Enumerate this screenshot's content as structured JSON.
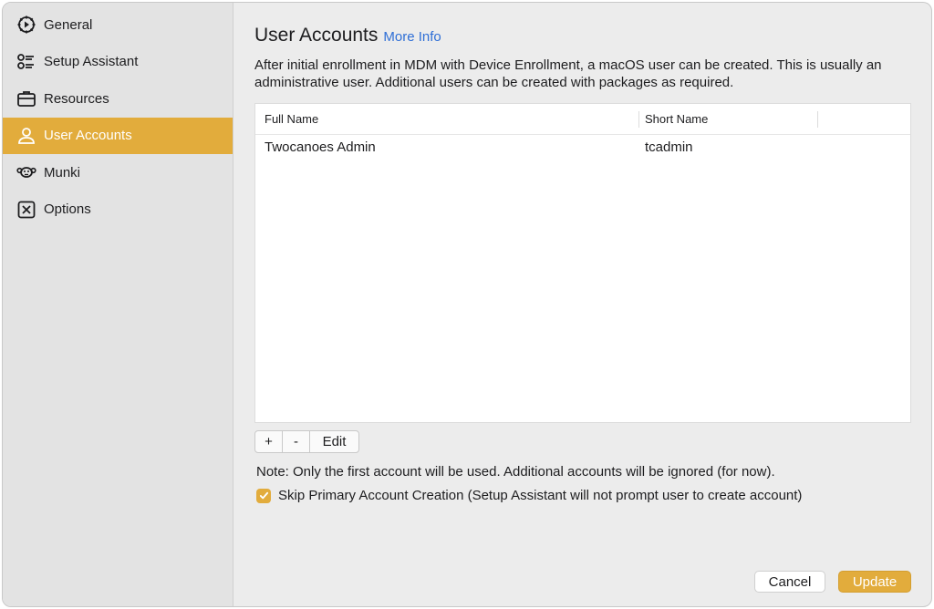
{
  "sidebar": {
    "items": [
      {
        "label": "General",
        "icon": "gear-icon"
      },
      {
        "label": "Setup Assistant",
        "icon": "checklist-icon"
      },
      {
        "label": "Resources",
        "icon": "briefcase-icon"
      },
      {
        "label": "User Accounts",
        "icon": "user-icon",
        "active": true
      },
      {
        "label": "Munki",
        "icon": "monkey-icon"
      },
      {
        "label": "Options",
        "icon": "x-box-icon"
      }
    ]
  },
  "main": {
    "title": "User Accounts",
    "more_info": "More Info",
    "description": "After initial enrollment in MDM with Device Enrollment, a macOS user can be created. This is usually an administrative user. Additional users can be created with packages as required.",
    "table": {
      "columns": [
        "Full Name",
        "Short Name"
      ],
      "rows": [
        {
          "full_name": "Twocanoes Admin",
          "short_name": "tcadmin"
        }
      ]
    },
    "buttons": {
      "add": "+",
      "remove": "-",
      "edit": "Edit"
    },
    "note": "Note: Only the first account will be used. Additional accounts will be ignored (for now).",
    "skip_checkbox": {
      "label": "Skip Primary Account Creation (Setup Assistant will not prompt user to create account)",
      "checked": true
    },
    "footer": {
      "cancel": "Cancel",
      "update": "Update"
    }
  },
  "colors": {
    "accent": "#e2ac3c",
    "link": "#2f6fd6"
  }
}
